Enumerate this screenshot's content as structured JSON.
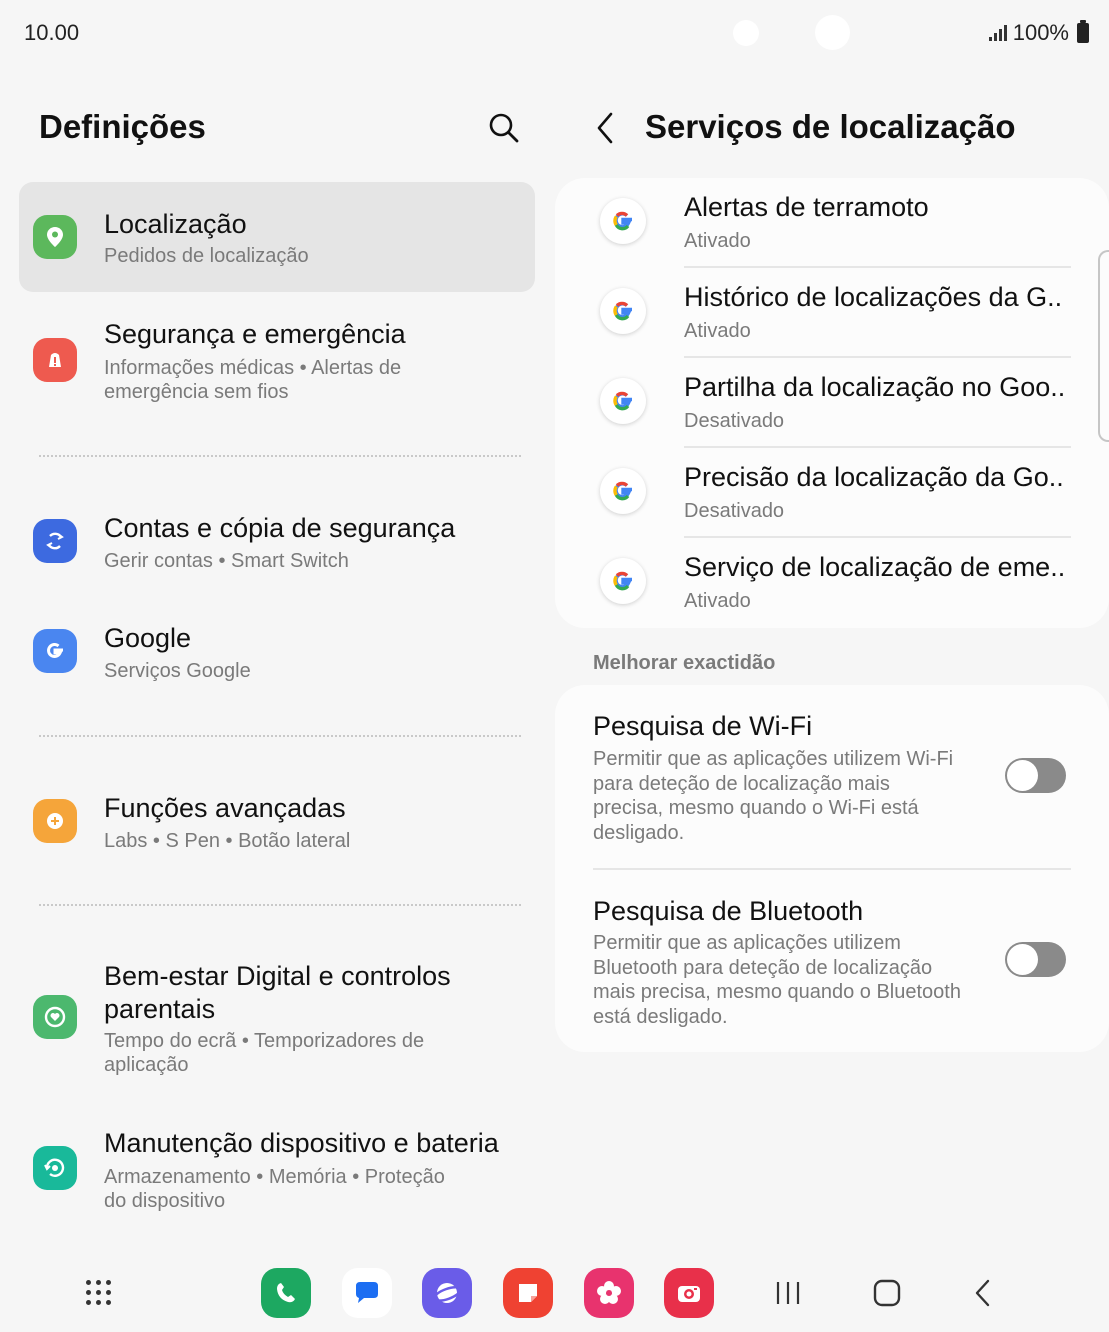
{
  "status_bar": {
    "time": "10.00",
    "battery": "100%"
  },
  "left_pane": {
    "title": "Definições",
    "items": [
      {
        "title": "Localização",
        "subtitle": "Pedidos de localização",
        "icon": "location-icon",
        "color": "#5cb85c"
      },
      {
        "title": "Segurança e emergência",
        "subtitle": "Informações médicas  •  Alertas de emergência sem fios",
        "icon": "emergency-icon",
        "color": "#ee5a4f"
      },
      {
        "title": "Contas e cópia de segurança",
        "subtitle": "Gerir contas  •  Smart Switch",
        "icon": "sync-icon",
        "color": "#3d6ae0"
      },
      {
        "title": "Google",
        "subtitle": "Serviços Google",
        "icon": "google-g-icon",
        "color": "#4a86f0"
      },
      {
        "title": "Funções avançadas",
        "subtitle": "Labs  •  S Pen  •  Botão lateral",
        "icon": "gear-plus-icon",
        "color": "#f5a53a"
      },
      {
        "title": "Bem-estar Digital e controlos parentais",
        "subtitle": "Tempo do ecrã  •  Temporizadores de aplicação",
        "icon": "wellbeing-icon",
        "color": "#4cb86e"
      },
      {
        "title": "Manutenção dispositivo e bateria",
        "subtitle": "Armazenamento  •  Memória  •  Proteção do dispositivo",
        "icon": "device-care-icon",
        "color": "#19b99a"
      }
    ]
  },
  "right_pane": {
    "title": "Serviços de localização",
    "google_services": [
      {
        "title": "Alertas de terramoto",
        "status": "Ativado"
      },
      {
        "title": "Histórico de localizações da G..",
        "status": "Ativado"
      },
      {
        "title": "Partilha da localização no Goo..",
        "status": "Desativado"
      },
      {
        "title": "Precisão da localização da Go..",
        "status": "Desativado"
      },
      {
        "title": "Serviço de localização de eme..",
        "status": "Ativado"
      }
    ],
    "section_header": "Melhorar exactidão",
    "toggles": [
      {
        "title": "Pesquisa de Wi-Fi",
        "description": "Permitir que as aplicações utilizem Wi-Fi para deteção de localização mais precisa, mesmo quando o Wi-Fi está desligado.",
        "enabled": false
      },
      {
        "title": "Pesquisa de Bluetooth",
        "description": "Permitir que as aplicações utilizem Bluetooth para deteção de localização mais precisa, mesmo quando o Bluetooth está desligado.",
        "enabled": false
      }
    ]
  },
  "dock": {
    "apps": [
      {
        "icon": "phone-app-icon",
        "color": "#1da861"
      },
      {
        "icon": "messages-app-icon",
        "color": "#ffffff"
      },
      {
        "icon": "internet-app-icon",
        "color": "#6a5ce8"
      },
      {
        "icon": "notes-app-icon",
        "color": "#ef4232"
      },
      {
        "icon": "gallery-app-icon",
        "color": "#e8336e"
      },
      {
        "icon": "camera-app-icon",
        "color": "#e8304a"
      }
    ]
  }
}
